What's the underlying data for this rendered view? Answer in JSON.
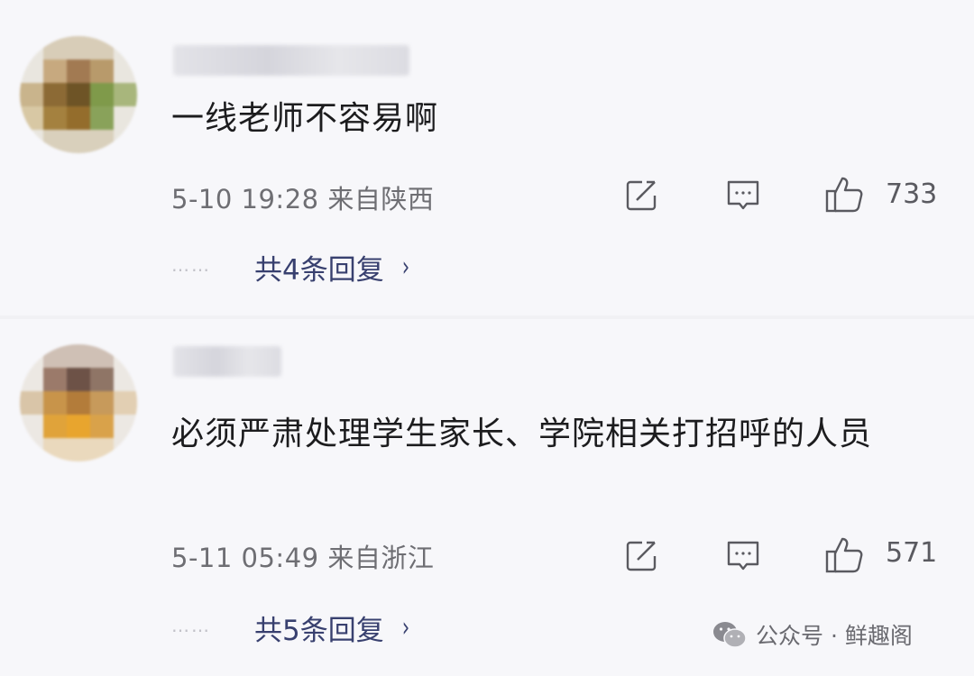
{
  "comments": [
    {
      "text": "一线老师不容易啊",
      "meta": "5-10 19:28  来自陕西",
      "likes": "733",
      "replies_dots": "……",
      "replies_label": "共4条回复"
    },
    {
      "text": "必须严肃处理学生家长、学院相关打招呼的人员",
      "meta": "5-11 05:49  来自浙江",
      "likes": "571",
      "replies_dots": "……",
      "replies_label": "共5条回复"
    }
  ],
  "icons": {
    "share": "share-icon",
    "comment": "comment-icon",
    "like": "thumbs-up-icon",
    "chevron": "chevron-right-icon",
    "watermark": "wechat-icon"
  },
  "chevron_glyph": "›",
  "watermark": {
    "label": "公众号 · 鲜趣阁"
  },
  "colors": {
    "reply_link": "#38406f",
    "meta": "#6e6e73",
    "text": "#1c1c1e"
  }
}
